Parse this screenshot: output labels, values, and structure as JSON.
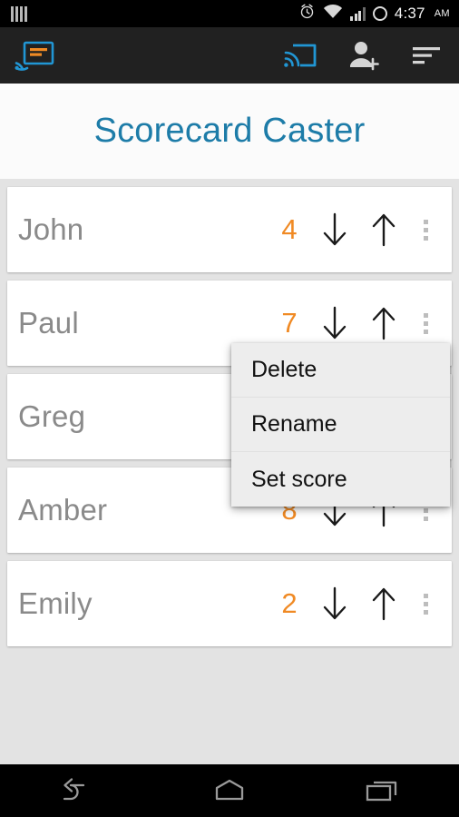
{
  "status_bar": {
    "notification_icon": "notification-bars-icon",
    "alarm_icon": "alarm-clock-icon",
    "wifi_icon": "wifi-icon",
    "signal_icon": "cellular-signal-icon",
    "battery_icon": "battery-ring-icon",
    "time": "4:37",
    "ampm": "AM"
  },
  "action_bar": {
    "logo_name": "scorecard-caster-logo",
    "logo_color": "#2196d4",
    "logo_accent_color": "#f08a24",
    "cast_icon": "cast-icon",
    "cast_color": "#2196d4",
    "add_person_icon": "add-person-icon",
    "overflow_icon": "sort-list-icon",
    "background": "#212121"
  },
  "header": {
    "title": "Scorecard Caster",
    "title_color": "#1d7ca8"
  },
  "list": {
    "score_color": "#f08a24",
    "name_color": "#8a8a8a",
    "down_arrow_icon": "arrow-down-icon",
    "up_arrow_icon": "arrow-up-icon",
    "overflow_icon": "more-vertical-icon",
    "players": [
      {
        "name": "John",
        "score": "4"
      },
      {
        "name": "Paul",
        "score": "7"
      },
      {
        "name": "Greg",
        "score": ""
      },
      {
        "name": "Amber",
        "score": "8"
      },
      {
        "name": "Emily",
        "score": "2"
      }
    ]
  },
  "popup_menu": {
    "open_for_row": "Paul",
    "items": [
      {
        "label": "Delete"
      },
      {
        "label": "Rename"
      },
      {
        "label": "Set score"
      }
    ]
  },
  "nav_bar": {
    "back_icon": "back-icon",
    "home_icon": "home-icon",
    "recents_icon": "recents-icon"
  }
}
